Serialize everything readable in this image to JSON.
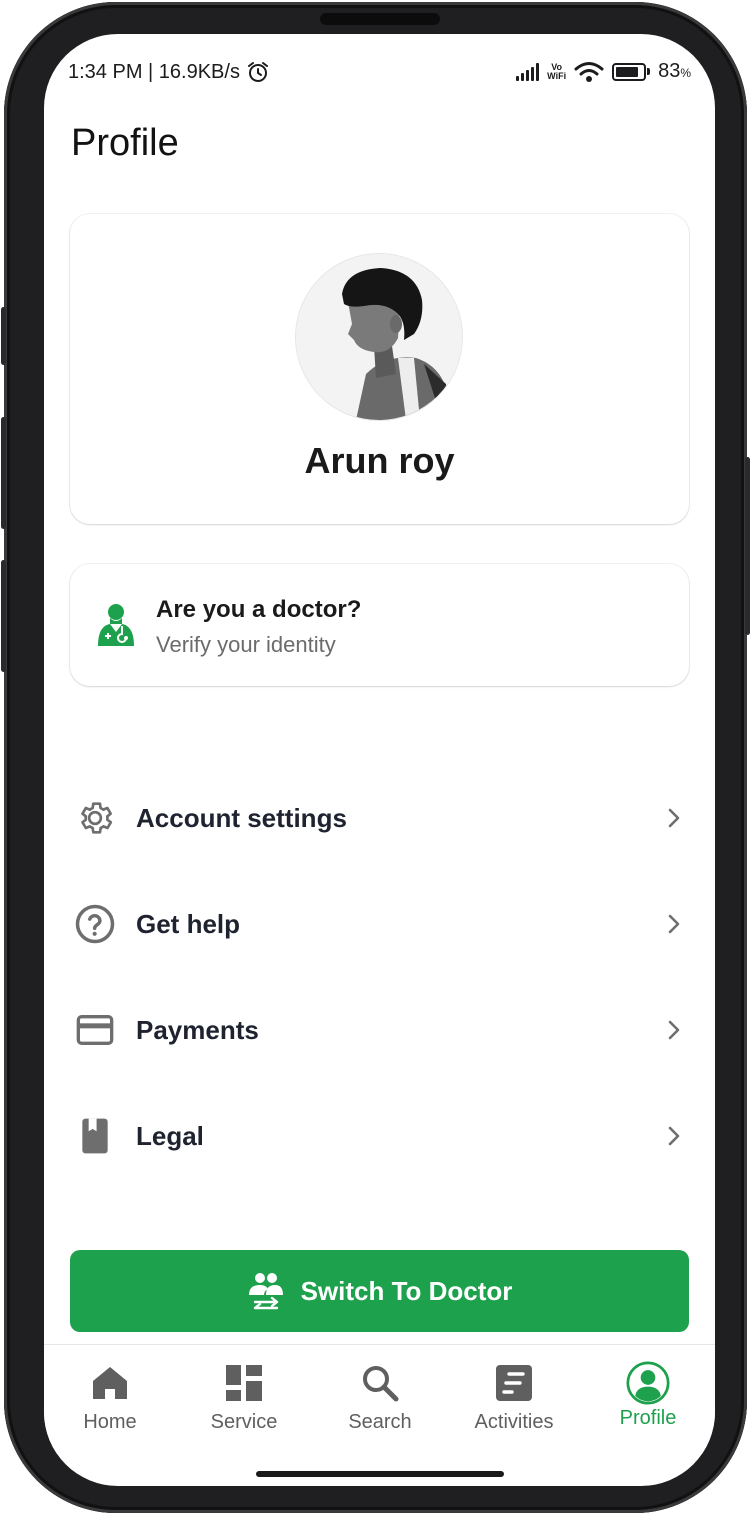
{
  "status_bar": {
    "time_speed": "1:34 PM | 16.9KB/s",
    "network_label_top": "Vo",
    "network_label_bottom": "WiFi",
    "battery_percent": "83",
    "battery_unit": "%",
    "battery_level": 0.83
  },
  "page": {
    "title": "Profile"
  },
  "profile": {
    "name": "Arun roy"
  },
  "doctor_card": {
    "title": "Are you a doctor?",
    "subtitle": "Verify your identity"
  },
  "menu": {
    "items": [
      {
        "label": "Account settings",
        "icon": "gear-icon"
      },
      {
        "label": "Get help",
        "icon": "help-circle-icon"
      },
      {
        "label": "Payments",
        "icon": "credit-card-icon"
      },
      {
        "label": "Legal",
        "icon": "book-icon"
      }
    ]
  },
  "switch_button": {
    "label": "Switch To Doctor"
  },
  "bottom_nav": {
    "items": [
      {
        "label": "Home",
        "icon": "home-icon"
      },
      {
        "label": "Service",
        "icon": "grid-icon"
      },
      {
        "label": "Search",
        "icon": "search-icon"
      },
      {
        "label": "Activities",
        "icon": "activities-icon"
      },
      {
        "label": "Profile",
        "icon": "profile-icon",
        "active": true
      }
    ]
  },
  "colors": {
    "accent": "#1ea14d",
    "text_primary": "#1f2330",
    "text_secondary": "#6b6b6b",
    "icon_gray": "#6e6e6e"
  }
}
